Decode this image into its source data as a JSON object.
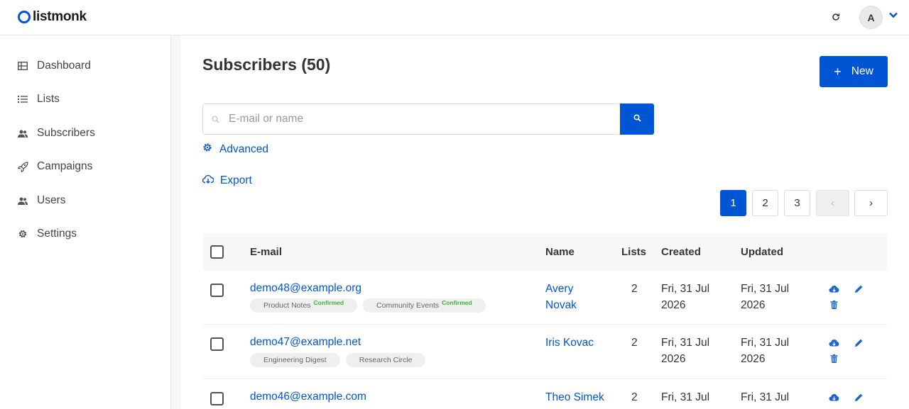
{
  "app": {
    "logo_text": "listmonk"
  },
  "header": {
    "avatar_initial": "A"
  },
  "sidebar": {
    "items": [
      {
        "label": "Dashboard",
        "icon": "dashboard-icon"
      },
      {
        "label": "Lists",
        "icon": "list-icon"
      },
      {
        "label": "Subscribers",
        "icon": "users-icon"
      },
      {
        "label": "Campaigns",
        "icon": "rocket-icon"
      },
      {
        "label": "Users",
        "icon": "users-icon"
      },
      {
        "label": "Settings",
        "icon": "gear-icon"
      }
    ]
  },
  "main": {
    "title": "Subscribers (50)",
    "new_button": {
      "plus": "+",
      "label": "New"
    },
    "search": {
      "placeholder": "E-mail or name",
      "value": ""
    },
    "advanced_label": "Advanced",
    "export_label": "Export",
    "pagination": {
      "pages": [
        "1",
        "2",
        "3"
      ],
      "current": "1",
      "prev": "‹",
      "next": "›"
    }
  },
  "table": {
    "columns": [
      "E-mail",
      "Name",
      "Lists",
      "Created",
      "Updated"
    ],
    "rows": [
      {
        "email": "demo48@example.org",
        "name_line1": "Avery",
        "name_line2": "Novak",
        "lists": "2",
        "created_line1": "Fri, 31 Jul",
        "created_line2": "2026",
        "updated_line1": "Fri, 31 Jul",
        "updated_line2": "2026",
        "tags": [
          {
            "label": "Product Notes",
            "status": "Confirmed"
          },
          {
            "label": "Community Events",
            "status": "Confirmed"
          }
        ]
      },
      {
        "email": "demo47@example.net",
        "name_line1": "Iris Kovac",
        "name_line2": "",
        "lists": "2",
        "created_line1": "Fri, 31 Jul",
        "created_line2": "2026",
        "updated_line1": "Fri, 31 Jul",
        "updated_line2": "2026",
        "tags": [
          {
            "label": "Engineering Digest",
            "status": ""
          },
          {
            "label": "Research Circle",
            "status": ""
          }
        ]
      },
      {
        "email": "demo46@example.com",
        "name_line1": "Theo Simek",
        "name_line2": "",
        "lists": "2",
        "created_line1": "Fri, 31 Jul",
        "created_line2": "",
        "updated_line1": "Fri, 31 Jul",
        "updated_line2": ""
      }
    ]
  },
  "colors": {
    "primary": "#0055d4",
    "confirmed": "#3bb33b"
  }
}
